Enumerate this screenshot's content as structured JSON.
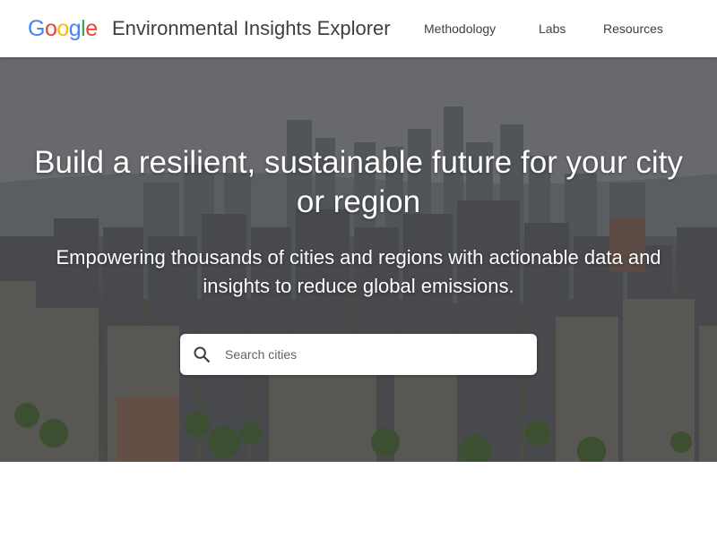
{
  "header": {
    "logo_letters": [
      {
        "char": "G",
        "color": "#4285F4"
      },
      {
        "char": "o",
        "color": "#EA4335"
      },
      {
        "char": "o",
        "color": "#FBBC05"
      },
      {
        "char": "g",
        "color": "#4285F4"
      },
      {
        "char": "l",
        "color": "#34A853"
      },
      {
        "char": "e",
        "color": "#EA4335"
      }
    ],
    "title": "Environmental Insights Explorer",
    "nav": [
      {
        "label": "Methodology"
      },
      {
        "label": "Labs"
      },
      {
        "label": "Resources"
      }
    ]
  },
  "hero": {
    "title": "Build a resilient, sustainable future for your city or region",
    "subtitle": "Empowering thousands of cities and regions with actionable data and insights to reduce global emissions.",
    "search": {
      "placeholder": "Search cities",
      "value": "",
      "icon": "search-icon"
    }
  },
  "colors": {
    "header_bg": "#ffffff",
    "text_dark": "#3c4043",
    "hero_text": "#ffffff"
  }
}
